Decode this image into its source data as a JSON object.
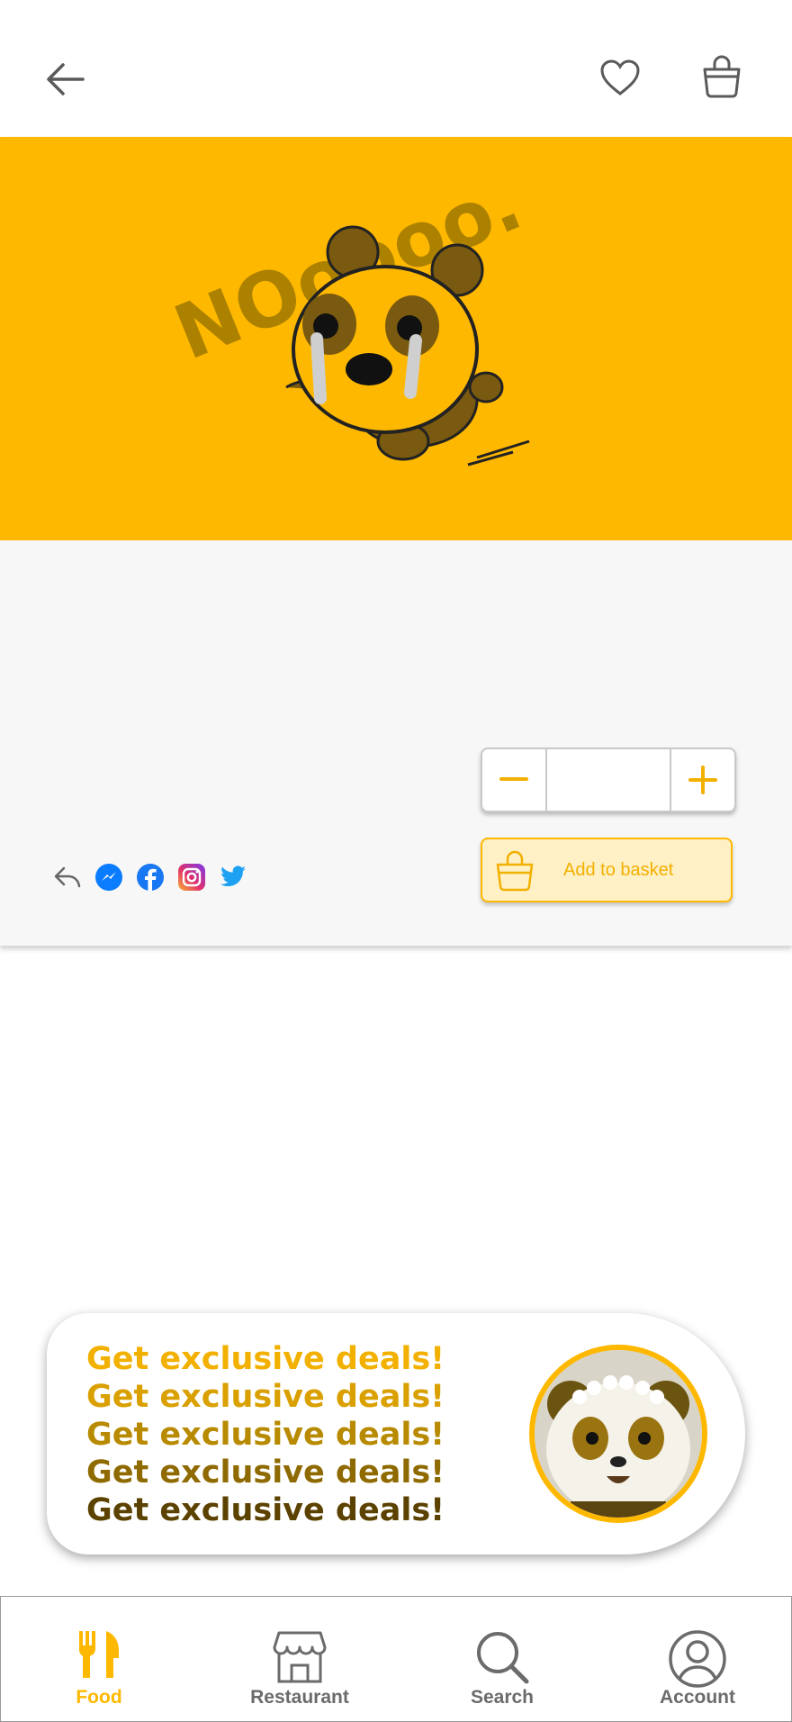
{
  "topbar": {
    "back_icon": "arrow-left-icon",
    "favorite_icon": "heart-icon",
    "basket_icon": "shopping-basket-icon"
  },
  "hero": {
    "background": "#FFB800",
    "illustration_text": "NOoooo.",
    "illustration": "crying-panda-illustration"
  },
  "quantity": {
    "minus_icon": "minus-icon",
    "plus_icon": "plus-icon",
    "value": ""
  },
  "add_to_basket": {
    "label": "Add to basket",
    "icon": "basket-icon"
  },
  "share": {
    "icons": [
      "share-icon",
      "messenger-icon",
      "facebook-icon",
      "instagram-icon",
      "twitter-icon"
    ]
  },
  "promo": {
    "lines": [
      {
        "text": "Get exclusive deals!",
        "color": "#F2B000"
      },
      {
        "text": "Get exclusive deals!",
        "color": "#D9A000"
      },
      {
        "text": "Get exclusive deals!",
        "color": "#B88A00"
      },
      {
        "text": "Get exclusive deals!",
        "color": "#8F6A00"
      },
      {
        "text": "Get exclusive deals!",
        "color": "#5C4200"
      }
    ],
    "avatar": "panda-with-flower-crown"
  },
  "bottom_nav": {
    "items": [
      {
        "label": "Food",
        "icon": "fork-knife-icon",
        "active": true
      },
      {
        "label": "Restaurant",
        "icon": "store-icon",
        "active": false
      },
      {
        "label": "Search",
        "icon": "search-icon",
        "active": false
      },
      {
        "label": "Account",
        "icon": "account-icon",
        "active": false
      }
    ]
  },
  "colors": {
    "accent": "#FFB800",
    "accent_text": "#F2B000",
    "inactive": "#6B6B6B",
    "panel_bg": "#F7F7F7"
  }
}
